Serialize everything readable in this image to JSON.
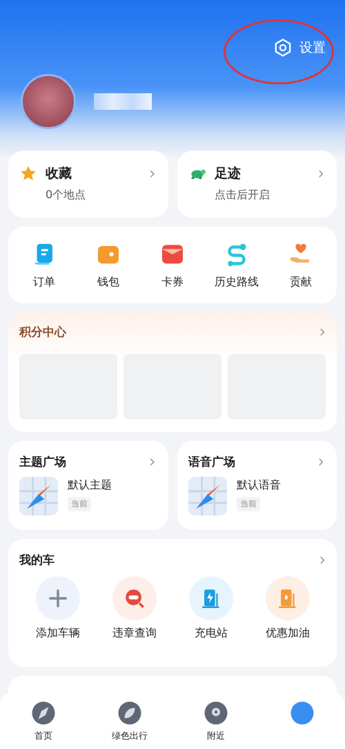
{
  "header": {
    "settings_label": "设置",
    "annotation": true
  },
  "shortcuts": [
    {
      "kind": "star",
      "title": "收藏",
      "subtitle": "0个地点",
      "chevron": "›"
    },
    {
      "kind": "turtle",
      "title": "足迹",
      "subtitle": "点击后开启",
      "chevron": "›"
    }
  ],
  "services": [
    {
      "kind": "order",
      "label": "订单"
    },
    {
      "kind": "wallet",
      "label": "钱包"
    },
    {
      "kind": "coupon",
      "label": "卡券"
    },
    {
      "kind": "route",
      "label": "历史路线"
    },
    {
      "kind": "heart",
      "label": "贡献"
    }
  ],
  "points": {
    "title": "积分中心",
    "chevron": "›",
    "tiles": [
      {
        "kind": "placeholder"
      },
      {
        "kind": "placeholder"
      },
      {
        "kind": "placeholder"
      }
    ]
  },
  "plazas": [
    {
      "title": "主题广场",
      "chevron": "›",
      "item": "默认主题",
      "tag": "当前"
    },
    {
      "title": "语音广场",
      "chevron": "›",
      "item": "默认语音",
      "tag": "当前"
    }
  ],
  "my_car": {
    "title": "我的车",
    "chevron": "›",
    "actions": [
      {
        "kind": "add",
        "label": "添加车辆"
      },
      {
        "kind": "violation",
        "label": "违章查询"
      },
      {
        "kind": "charge",
        "label": "充电站"
      },
      {
        "kind": "fuel",
        "label": "优惠加油"
      }
    ]
  },
  "bottom_nav": [
    {
      "kind": "compass",
      "label": "首页"
    },
    {
      "kind": "leaf",
      "label": "绿色出行"
    },
    {
      "kind": "pin",
      "label": "附近"
    },
    {
      "kind": "blue"
    }
  ]
}
